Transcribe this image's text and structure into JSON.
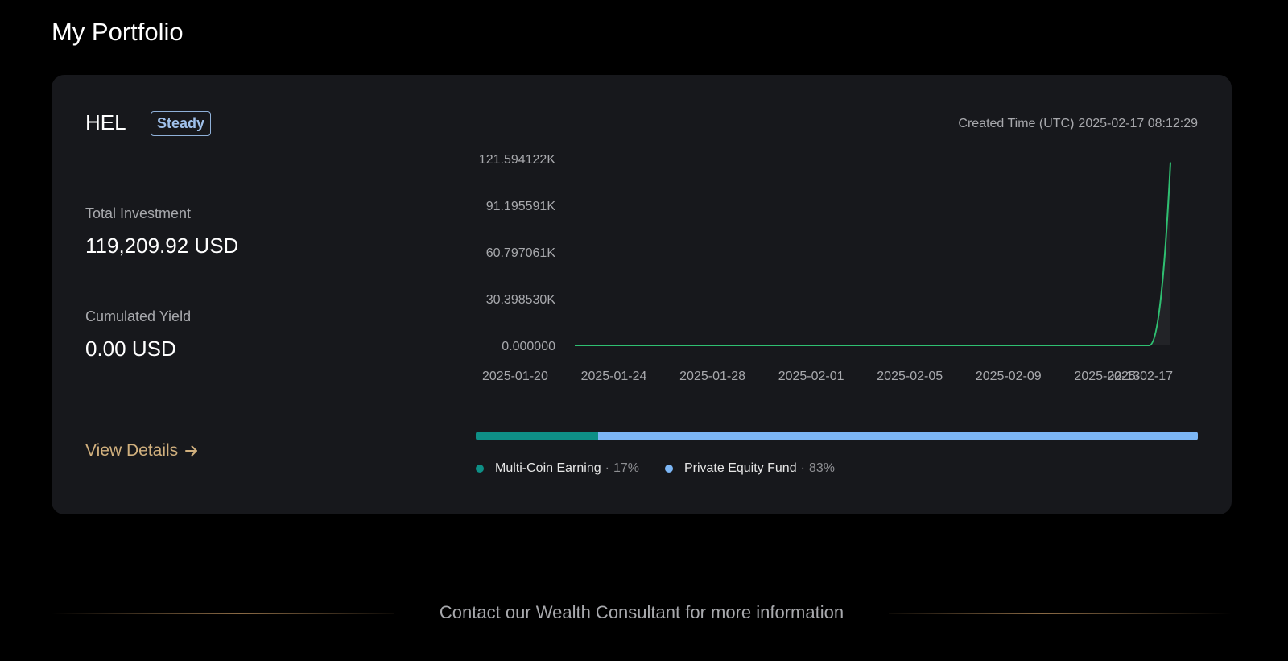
{
  "page": {
    "title": "My Portfolio"
  },
  "portfolio": {
    "name": "HEL",
    "badge": "Steady",
    "created_label": "Created Time (UTC)",
    "created_value": "2025-02-17 08:12:29",
    "total_investment_label": "Total Investment",
    "total_investment_value": "119,209.92 USD",
    "cumulated_yield_label": "Cumulated Yield",
    "cumulated_yield_value": "0.00 USD",
    "view_details_label": "View Details"
  },
  "chart_data": {
    "type": "line",
    "title": "",
    "xlabel": "",
    "ylabel": "",
    "x_ticks": [
      "2025-01-20",
      "2025-01-24",
      "2025-01-28",
      "2025-02-01",
      "2025-02-05",
      "2025-02-09",
      "2025-02-13",
      "2025-02-17"
    ],
    "y_ticks": [
      "0.000000",
      "30.398530K",
      "60.797061K",
      "91.195591K",
      "121.594122K"
    ],
    "ylim": [
      0,
      121594.122
    ],
    "xlim": [
      "2025-01-20",
      "2025-02-17"
    ],
    "grid": false,
    "line_color": "#2fbf71",
    "series": [
      {
        "points": [
          {
            "x": "2025-01-20",
            "y": 0
          },
          {
            "x": "2025-02-16",
            "y": 0
          },
          {
            "x": "2025-02-17",
            "y": 119209.92
          }
        ]
      }
    ]
  },
  "allocation": [
    {
      "name": "Multi-Coin Earning",
      "percent": "17%",
      "fraction": 0.17,
      "color": "#0e8f86"
    },
    {
      "name": "Private Equity Fund",
      "percent": "83%",
      "fraction": 0.83,
      "color": "#7cb6f5"
    }
  ],
  "legend_separator": "·",
  "footer": {
    "text": "Contact our Wealth Consultant for more information"
  }
}
